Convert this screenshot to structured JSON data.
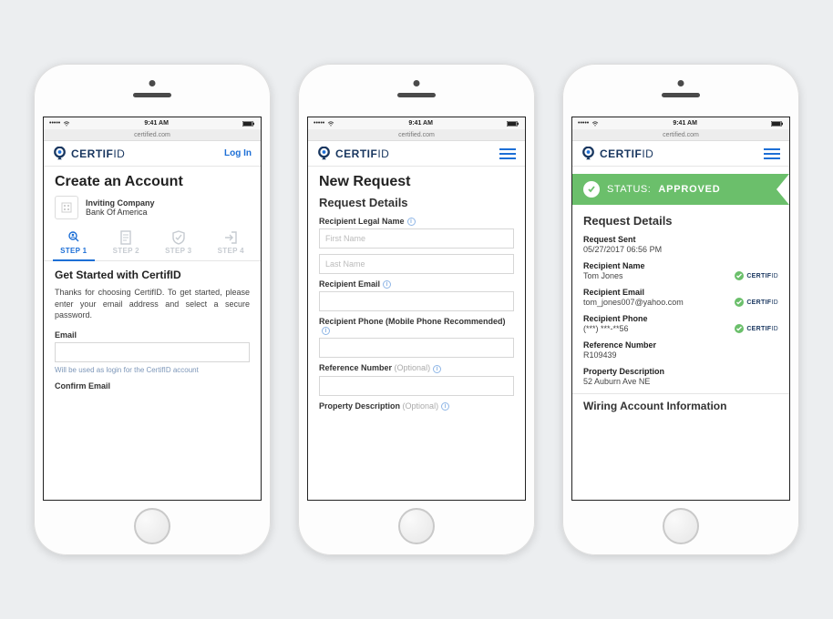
{
  "statusbar": {
    "carrier": "•••••",
    "wifi": "wifi",
    "time": "9:41 AM",
    "battery": "100%"
  },
  "addressbar": "certified.com",
  "brand": {
    "name_bold": "CERTIF",
    "name_thin": "ID"
  },
  "screen1": {
    "login": "Log In",
    "title": "Create an Account",
    "company_label": "Inviting Company",
    "company_name": "Bank Of America",
    "steps": [
      {
        "label": "STEP 1",
        "active": true
      },
      {
        "label": "STEP 2",
        "active": false
      },
      {
        "label": "STEP 3",
        "active": false
      },
      {
        "label": "STEP 4",
        "active": false
      }
    ],
    "subtitle": "Get Started with CertifID",
    "paragraph": "Thanks for choosing CertifID. To get started, please enter your email address and select a secure password.",
    "email_label": "Email",
    "email_hint": "Will be used as login for the CertifID account",
    "confirm_email_label": "Confirm Email"
  },
  "screen2": {
    "title": "New Request",
    "section": "Request Details",
    "fields": {
      "legal_name_label": "Recipient Legal Name",
      "first_name_placeholder": "First Name",
      "last_name_placeholder": "Last Name",
      "email_label": "Recipient Email",
      "phone_label": "Recipient Phone (Mobile Phone Recommended)",
      "reference_label": "Reference Number",
      "property_label": "Property Description",
      "optional": "(Optional)"
    }
  },
  "screen3": {
    "status_label": "STATUS:",
    "status_value": "APPROVED",
    "section": "Request Details",
    "details": [
      {
        "label": "Request Sent",
        "value": "05/27/2017 06:56 PM",
        "verified": false
      },
      {
        "label": "Recipient Name",
        "value": "Tom Jones",
        "verified": true
      },
      {
        "label": "Recipient Email",
        "value": "tom_jones007@yahoo.com",
        "verified": true
      },
      {
        "label": "Recipient Phone",
        "value": "(***) ***-**56",
        "verified": true
      },
      {
        "label": "Reference Number",
        "value": "R109439",
        "verified": false
      },
      {
        "label": "Property Description",
        "value": "52 Auburn Ave NE",
        "verified": false
      }
    ],
    "wiring_section": "Wiring Account Information"
  }
}
